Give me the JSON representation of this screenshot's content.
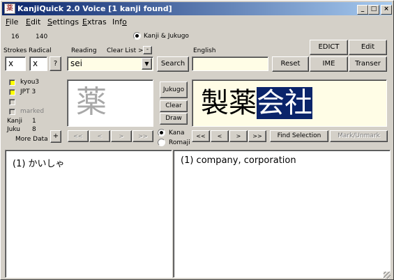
{
  "window": {
    "title": "KanjiQuick 2.0 Voice   [1 kanji found]",
    "app_icon_glyph": "薬",
    "controls": {
      "minimize": "_",
      "maximize": "□",
      "close": "×"
    }
  },
  "menu": [
    "File",
    "Edit",
    "Settings",
    "Extras",
    "Info"
  ],
  "top_row": {
    "strokes_count": "16",
    "radical_count": "140",
    "mode_label": "Kanji & Jukugo"
  },
  "labels": {
    "strokes": "Strokes",
    "radical": "Radical",
    "reading": "Reading",
    "clear_list": "Clear List >",
    "english": "English"
  },
  "fields": {
    "strokes_value": "x",
    "radical_value": "x",
    "radical_help": "?",
    "reading_value": "sei",
    "english_value": "",
    "clear_list_btn": "-"
  },
  "buttons": {
    "search": "Search",
    "reset": "Reset",
    "edict": "EDICT",
    "edit": "Edit",
    "ime": "IME",
    "transfer": "Transer",
    "jukugo": "Jukugo",
    "clear": "Clear",
    "draw": "Draw",
    "more_data_plus": "+",
    "find_selection": "Find Selection",
    "mark_unmark": "Mark/Unmark"
  },
  "left_panel": {
    "checks": [
      {
        "label": "kyou3",
        "color": "#ffff00",
        "disabled": false
      },
      {
        "label": "JPT 3",
        "color": "#ffff00",
        "disabled": false
      },
      {
        "label": "",
        "color": "#ffffff",
        "disabled": true
      },
      {
        "label": "marked",
        "color": "#ffffff",
        "disabled": true
      }
    ],
    "kanji_label": "Kanji",
    "kanji_count": "1",
    "juku_label": "Juku",
    "juku_count": "8",
    "more_data": "More Data"
  },
  "kanji_display": "薬",
  "nav_left": [
    "<<",
    "<",
    ">",
    ">>"
  ],
  "nav_right": [
    "<<",
    "<",
    ">",
    ">>"
  ],
  "output_mode": {
    "kana": "Kana",
    "romaji": "Romaji",
    "selected": "kana"
  },
  "jukugo_display": {
    "chars": [
      "製",
      "薬",
      "会",
      "社"
    ],
    "highlight_from": 2
  },
  "results": {
    "reading": "(1) かいしゃ",
    "meaning": "(1)  company, corporation"
  }
}
